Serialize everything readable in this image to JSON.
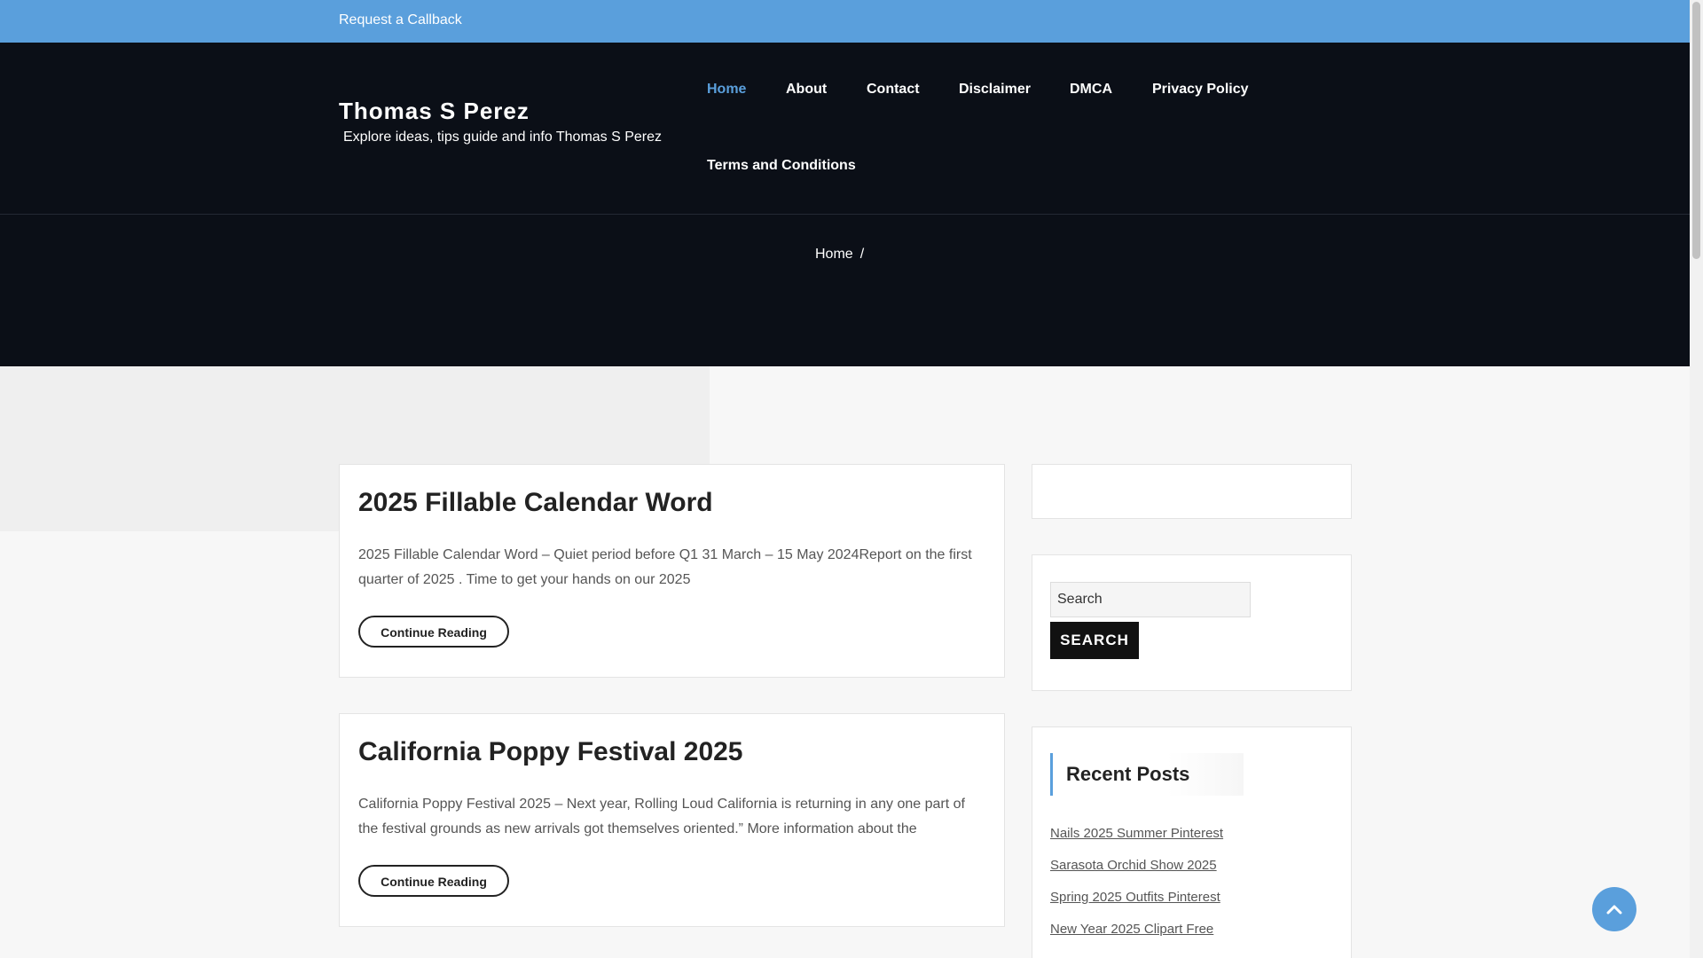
{
  "topbar": {
    "callback_label": "Request a Callback"
  },
  "site": {
    "title": "Thomas S Perez",
    "tagline": "Explore ideas, tips guide and info Thomas S Perez"
  },
  "nav": {
    "items": [
      {
        "label": "Home",
        "active": true
      },
      {
        "label": "About"
      },
      {
        "label": "Contact"
      },
      {
        "label": "Disclaimer"
      },
      {
        "label": "DMCA"
      },
      {
        "label": "Privacy Policy"
      },
      {
        "label": "Terms and Conditions"
      }
    ]
  },
  "breadcrumb": {
    "home": "Home",
    "separator": "/"
  },
  "posts": [
    {
      "title": "2025 Fillable Calendar Word",
      "excerpt": "2025 Fillable Calendar Word – Quiet period before Q1 31 March – 15 May 2024Report on the first quarter of 2025 . Time to get your hands on our 2025",
      "button": "Continue Reading"
    },
    {
      "title": "California Poppy Festival 2025",
      "excerpt": "California Poppy Festival 2025 – Next year, Rolling Loud California is returning in any one part of the festival grounds as new arrivals got themselves oriented.” More information about the",
      "button": "Continue Reading"
    }
  ],
  "sidebar": {
    "search": {
      "placeholder": "Search",
      "button_label": "SEARCH"
    },
    "recent": {
      "title": "Recent Posts",
      "items": [
        "Nails 2025 Summer Pinterest",
        "Sarasota Orchid Show 2025",
        "Spring 2025 Outfits Pinterest",
        "New Year 2025 Clipart Free"
      ]
    }
  },
  "icons": {
    "back_to_top": "chevron-up-icon"
  },
  "colors": {
    "accent": "#5a9fdc",
    "header_bg": "#0b0f17",
    "page_bg": "#f7f7f7"
  }
}
